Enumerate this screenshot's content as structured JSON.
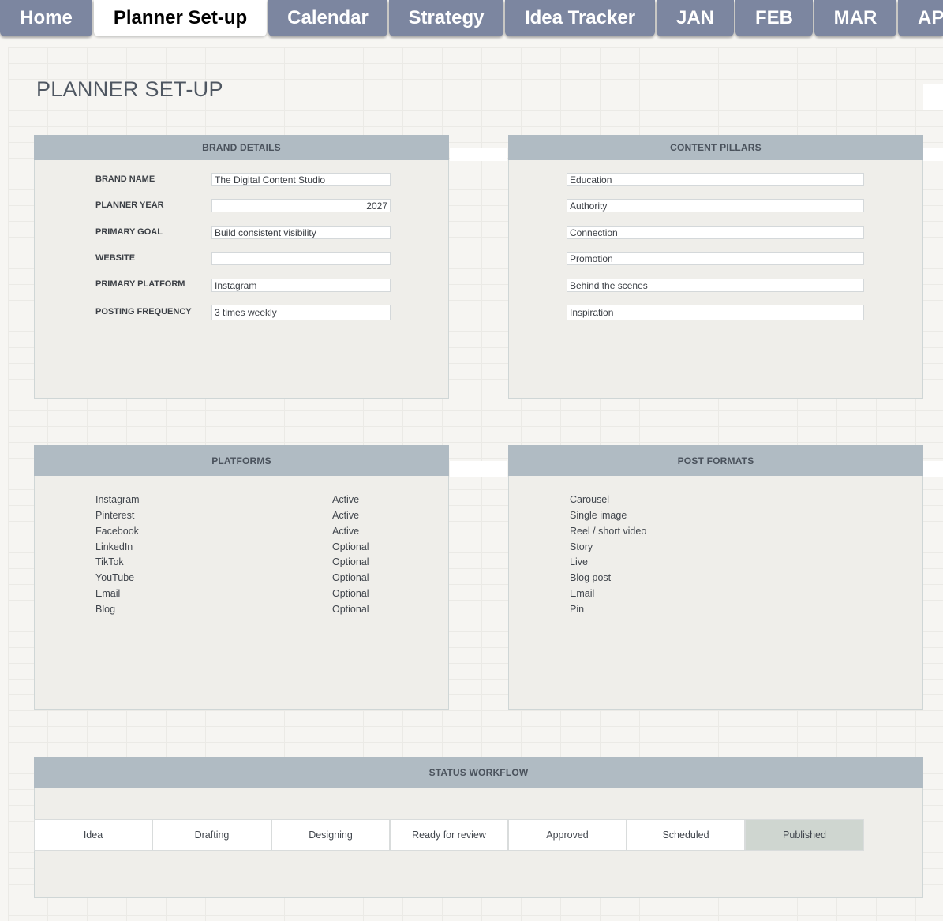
{
  "tabs": [
    {
      "label": "Home",
      "active": false
    },
    {
      "label": "Planner Set-up",
      "active": true
    },
    {
      "label": "Calendar",
      "active": false
    },
    {
      "label": "Strategy",
      "active": false
    },
    {
      "label": "Idea Tracker",
      "active": false
    },
    {
      "label": "JAN",
      "active": false
    },
    {
      "label": "FEB",
      "active": false
    },
    {
      "label": "MAR",
      "active": false
    },
    {
      "label": "AP",
      "active": false
    }
  ],
  "page_title": "PLANNER SET-UP",
  "brand_details": {
    "title": "BRAND DETAILS",
    "fields": [
      {
        "label": "BRAND NAME",
        "value": "The Digital Content Studio"
      },
      {
        "label": "PLANNER YEAR",
        "value": "2027"
      },
      {
        "label": "PRIMARY GOAL",
        "value": "Build consistent visibility"
      },
      {
        "label": "WEBSITE",
        "value": ""
      },
      {
        "label": "PRIMARY PLATFORM",
        "value": "Instagram"
      },
      {
        "label": "POSTING FREQUENCY",
        "value": "3 times weekly"
      }
    ]
  },
  "content_pillars": {
    "title": "CONTENT PILLARS",
    "items": [
      "Education",
      "Authority",
      "Connection",
      "Promotion",
      "Behind the scenes",
      "Inspiration"
    ]
  },
  "platforms": {
    "title": "PLATFORMS",
    "rows": [
      {
        "name": "Instagram",
        "status": "Active"
      },
      {
        "name": "Pinterest",
        "status": "Active"
      },
      {
        "name": "Facebook",
        "status": "Active"
      },
      {
        "name": "LinkedIn",
        "status": "Optional"
      },
      {
        "name": "TikTok",
        "status": "Optional"
      },
      {
        "name": "YouTube",
        "status": "Optional"
      },
      {
        "name": "Email",
        "status": "Optional"
      },
      {
        "name": "Blog",
        "status": "Optional"
      }
    ]
  },
  "post_formats": {
    "title": "POST FORMATS",
    "items": [
      "Carousel",
      "Single image",
      "Reel / short video",
      "Story",
      "Live",
      "Blog post",
      "Email",
      "Pin"
    ]
  },
  "status_workflow": {
    "title": "STATUS WORKFLOW",
    "steps": [
      "Idea",
      "Drafting",
      "Designing",
      "Ready for review",
      "Approved",
      "Scheduled",
      "Published"
    ]
  },
  "colors": {
    "tab_bg": "#7c86a0",
    "tab_active_bg": "#ffffff",
    "panel_header": "#b0bbc3",
    "panel_body": "#efeeea",
    "workflow_highlight": "#cfd6d0"
  }
}
